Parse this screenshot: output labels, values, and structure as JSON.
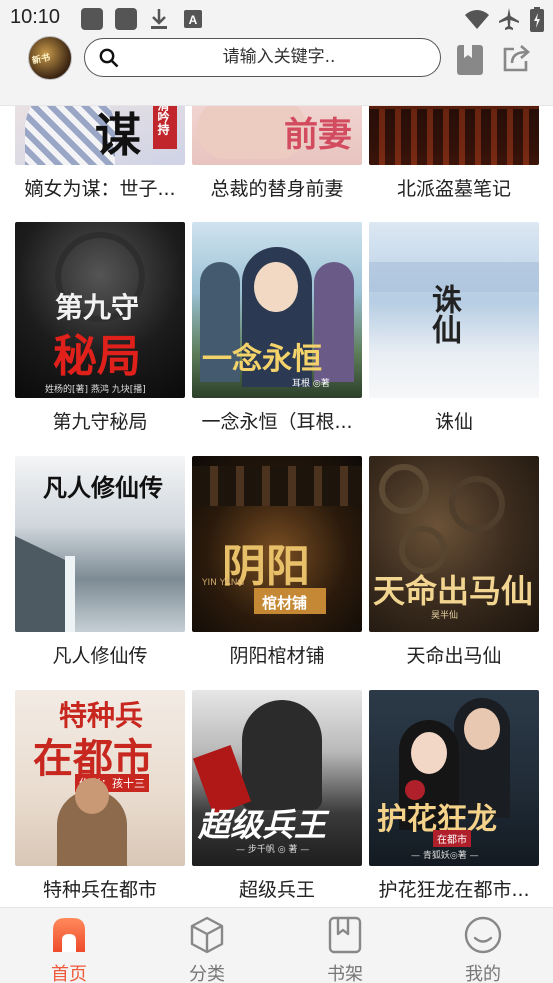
{
  "status_bar": {
    "time": "10:10",
    "icons": [
      "notification-square-icon",
      "notification-square-icon",
      "download-icon",
      "a-badge-icon",
      "wifi-icon",
      "airplane-icon",
      "battery-icon"
    ]
  },
  "header": {
    "avatar_text": "新书",
    "search_placeholder": "请输入关键字..",
    "bookmark_icon": "bookmark-icon",
    "share_icon": "share-icon"
  },
  "books": [
    {
      "title": "嫡女为谋：世子...",
      "cover_text": "谋",
      "cover_sub": "清吟持"
    },
    {
      "title": "总裁的替身前妻",
      "cover_text": "前妻",
      "cover_sub": ""
    },
    {
      "title": "北派盗墓笔记",
      "cover_text": "",
      "cover_sub": ""
    },
    {
      "title": "第九守秘局",
      "cover_text": "第九守",
      "cover_text2": "秘局",
      "cover_sub": "姓杨的[著] 燕鸿 九块[播]"
    },
    {
      "title": "一念永恒（耳根...",
      "cover_text": "一念永恒",
      "cover_sub": "耳根 ◎著"
    },
    {
      "title": "诛仙",
      "cover_text": "诛仙",
      "cover_sub": ""
    },
    {
      "title": "凡人修仙传",
      "cover_text": "凡人修仙传",
      "cover_sub": ""
    },
    {
      "title": "阴阳棺材铺",
      "cover_text": "阴阳",
      "cover_text2": "棺材铺",
      "cover_sub": "YIN YANG"
    },
    {
      "title": "天命出马仙",
      "cover_text": "天命出马仙",
      "cover_sub": "昊半仙"
    },
    {
      "title": "特种兵在都市",
      "cover_text": "特种兵",
      "cover_text2": "在都市",
      "cover_sub": "作者：孩十三"
    },
    {
      "title": "超级兵王",
      "cover_text": "超级兵王",
      "cover_sub": "— 步千帆 ◎ 著 —"
    },
    {
      "title": "护花狂龙在都市...",
      "cover_text": "护花狂龙",
      "cover_text2": "在都市",
      "cover_sub": "— 青狐妖◎著 —"
    }
  ],
  "nav": [
    {
      "label": "首页",
      "icon": "home-icon",
      "active": true
    },
    {
      "label": "分类",
      "icon": "category-cube-icon",
      "active": false
    },
    {
      "label": "书架",
      "icon": "bookshelf-icon",
      "active": false
    },
    {
      "label": "我的",
      "icon": "profile-smile-icon",
      "active": false
    }
  ],
  "colors": {
    "accent": "#ee5a3c",
    "nav_inactive": "#777777",
    "bar_background": "#f3f3f3"
  }
}
